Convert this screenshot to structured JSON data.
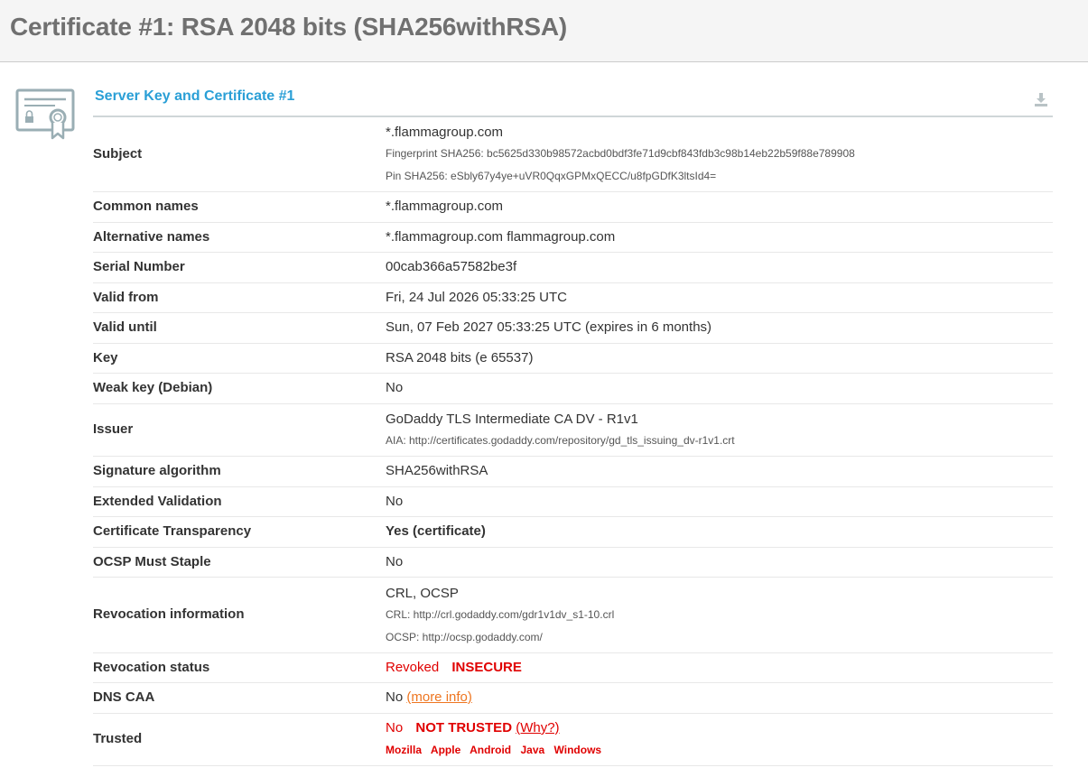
{
  "page": {
    "title": "Certificate #1: RSA 2048 bits (SHA256withRSA)"
  },
  "section": {
    "title": "Server Key and Certificate #1",
    "icon": "certificate-icon",
    "download_icon": "download-icon"
  },
  "rows": {
    "subject": {
      "label": "Subject",
      "value": "*.flammagroup.com",
      "fingerprint": "Fingerprint SHA256: bc5625d330b98572acbd0bdf3fe71d9cbf843fdb3c98b14eb22b59f88e789908",
      "pin": "Pin SHA256: eSbly67y4ye+uVR0QqxGPMxQECC/u8fpGDfK3ltsId4="
    },
    "common_names": {
      "label": "Common names",
      "value": "*.flammagroup.com"
    },
    "alt_names": {
      "label": "Alternative names",
      "value": "*.flammagroup.com flammagroup.com"
    },
    "serial": {
      "label": "Serial Number",
      "value": "00cab366a57582be3f"
    },
    "valid_from": {
      "label": "Valid from",
      "value": "Fri, 24 Jul 2026 05:33:25 UTC"
    },
    "valid_until": {
      "label": "Valid until",
      "value": "Sun, 07 Feb 2027 05:33:25 UTC (expires in 6 months)"
    },
    "key": {
      "label": "Key",
      "value": "RSA 2048 bits (e 65537)"
    },
    "weak_key": {
      "label": "Weak key (Debian)",
      "value": "No"
    },
    "issuer": {
      "label": "Issuer",
      "value": "GoDaddy TLS Intermediate CA DV - R1v1",
      "aia": "AIA: http://certificates.godaddy.com/repository/gd_tls_issuing_dv-r1v1.crt"
    },
    "sig_alg": {
      "label": "Signature algorithm",
      "value": "SHA256withRSA"
    },
    "ev": {
      "label": "Extended Validation",
      "value": "No"
    },
    "ct": {
      "label": "Certificate Transparency",
      "value": "Yes (certificate)"
    },
    "ocsp_staple": {
      "label": "OCSP Must Staple",
      "value": "No"
    },
    "revocation_info": {
      "label": "Revocation information",
      "value": "CRL, OCSP",
      "crl": "CRL: http://crl.godaddy.com/gdr1v1dv_s1-10.crl",
      "ocsp": "OCSP: http://ocsp.godaddy.com/"
    },
    "revocation_status": {
      "label": "Revocation status",
      "value": "Revoked",
      "flag": "INSECURE"
    },
    "dns_caa": {
      "label": "DNS CAA",
      "value": "No",
      "link": "(more info)"
    },
    "trusted": {
      "label": "Trusted",
      "value": "No",
      "flag": "NOT TRUSTED",
      "link": "(Why?)",
      "platforms": [
        "Mozilla",
        "Apple",
        "Android",
        "Java",
        "Windows"
      ]
    }
  },
  "colors": {
    "section_title": "#2a9fd6",
    "good": "#008000",
    "bad": "#e00000",
    "warning": "#ee7621",
    "header_text": "#707070"
  }
}
